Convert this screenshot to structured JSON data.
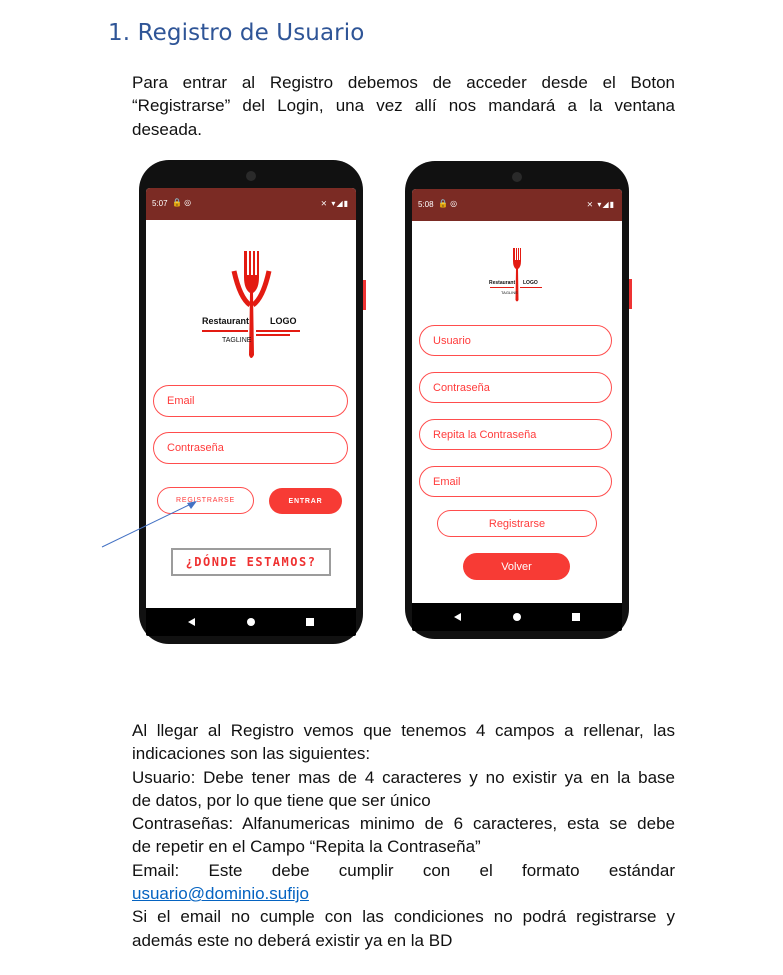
{
  "heading": {
    "number": "1.",
    "title": "Registro de Usuario"
  },
  "intro": {
    "lines": [
      "Para entrar al Registro debemos de acceder desde el Boton",
      "“Registrarse” del Login, una vez allí nos mandará a la ventana",
      "deseada."
    ]
  },
  "login_phone": {
    "status_time": "5:07",
    "status_left_icons": "🔒 ◎",
    "status_right_icons": "⨯ ▾◢▮",
    "logo": {
      "brand": "Restaurant",
      "word": "LOGO",
      "tagline": "TAGLINE"
    },
    "email_placeholder": "Email",
    "password_placeholder": "Contraseña",
    "register_label": "REGISTRARSE",
    "login_label": "ENTRAR",
    "where_label": "¿DÓNDE ESTAMOS?"
  },
  "register_phone": {
    "status_time": "5:08",
    "status_left_icons": "🔒 ◎",
    "status_right_icons": "⨯ ▾◢▮",
    "logo": {
      "brand": "Restaurant",
      "word": "LOGO",
      "tagline": "TAGLINE"
    },
    "user_placeholder": "Usuario",
    "password_placeholder": "Contraseña",
    "repeat_placeholder": "Repita la Contraseña",
    "email_placeholder": "Email",
    "register_label": "Registrarse",
    "back_label": "Volver"
  },
  "details": {
    "line1": "Al llegar al Registro vemos que tenemos 4 campos a rellenar, las",
    "line2": "indicaciones son las siguientes:",
    "line3": "Usuario: Debe tener mas de 4 caracteres y no existir ya en la base",
    "line4": "de datos, por lo que tiene que ser único",
    "line5": "Contraseñas: Alfanumericas minimo de 6 caracteres, esta se debe",
    "line6": "de repetir en el Campo “Repita la Contraseña”",
    "line7": "Email: Este debe cumplir con el formato estándar",
    "email_example": "usuario@dominio.sufijo",
    "line9": "Si el email no cumple con las condiciones no podrá registrarse y",
    "line10": "además este no deberá existir ya en la BD"
  },
  "colors": {
    "accent": "#f73b35",
    "statusbar": "#7b2b24",
    "heading": "#2f5597",
    "link": "#0563c1"
  }
}
